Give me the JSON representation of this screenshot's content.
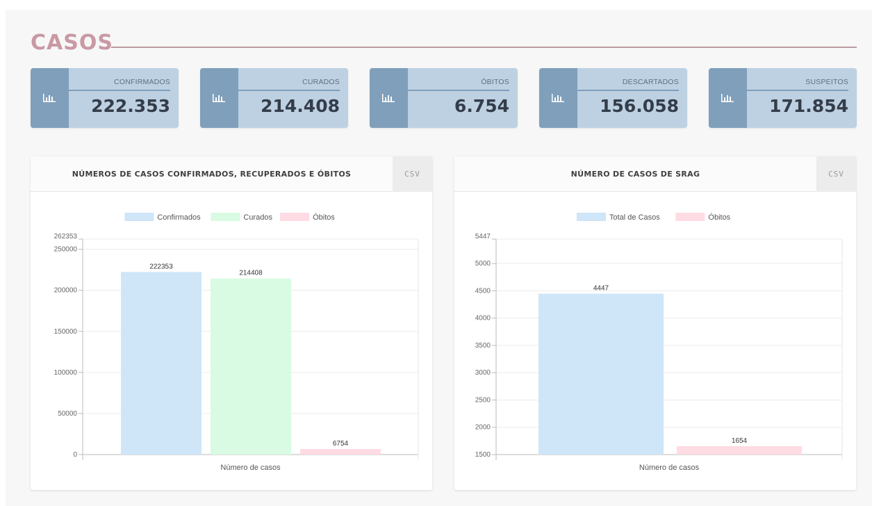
{
  "section": {
    "title": "CASOS"
  },
  "stats": [
    {
      "label": "CONFIRMADOS",
      "value": "222.353",
      "icon": "bar-chart-icon"
    },
    {
      "label": "CURADOS",
      "value": "214.408",
      "icon": "bar-chart-icon"
    },
    {
      "label": "ÓBITOS",
      "value": "6.754",
      "icon": "bar-chart-icon"
    },
    {
      "label": "DESCARTADOS",
      "value": "156.058",
      "icon": "bar-chart-icon"
    },
    {
      "label": "SUSPEITOS",
      "value": "171.854",
      "icon": "bar-chart-icon"
    }
  ],
  "panels": [
    {
      "title": "NÚMEROS DE CASOS CONFIRMADOS, RECUPERADOS E ÓBITOS",
      "csv_label": "CSV"
    },
    {
      "title": "NÚMERO DE CASOS DE SRAG",
      "csv_label": "CSV"
    }
  ],
  "colors": {
    "accent_title": "#c999a4",
    "card_bg": "#bdd1e2",
    "card_icon_bg": "#7f9fbb",
    "confirmados": "#cfe5f8",
    "curados": "#d9fbe3",
    "obitos": "#ffdbe3"
  },
  "chart_data": [
    {
      "type": "bar",
      "title": "",
      "xlabel": "Número de casos",
      "ylabel": "",
      "categories": [
        "Número de casos"
      ],
      "series": [
        {
          "name": "Confirmados",
          "values": [
            222353
          ],
          "color": "#cfe5f8"
        },
        {
          "name": "Curados",
          "values": [
            214408
          ],
          "color": "#d9fbe3"
        },
        {
          "name": "Óbitos",
          "values": [
            6754
          ],
          "color": "#ffdbe3"
        }
      ],
      "yticks": [
        0,
        50000,
        100000,
        150000,
        200000,
        250000,
        262353
      ],
      "ylim": [
        0,
        262353
      ],
      "grid": true,
      "legend": "top"
    },
    {
      "type": "bar",
      "title": "",
      "xlabel": "Número de casos",
      "ylabel": "",
      "categories": [
        "Número de casos"
      ],
      "series": [
        {
          "name": "Total de Casos",
          "values": [
            4447
          ],
          "color": "#cfe5f8"
        },
        {
          "name": "Óbitos",
          "values": [
            1654
          ],
          "color": "#ffdbe3"
        }
      ],
      "yticks": [
        1500,
        2000,
        2500,
        3000,
        3500,
        4000,
        4500,
        5000,
        5447
      ],
      "ylim": [
        1500,
        5447
      ],
      "grid": true,
      "legend": "top"
    }
  ]
}
